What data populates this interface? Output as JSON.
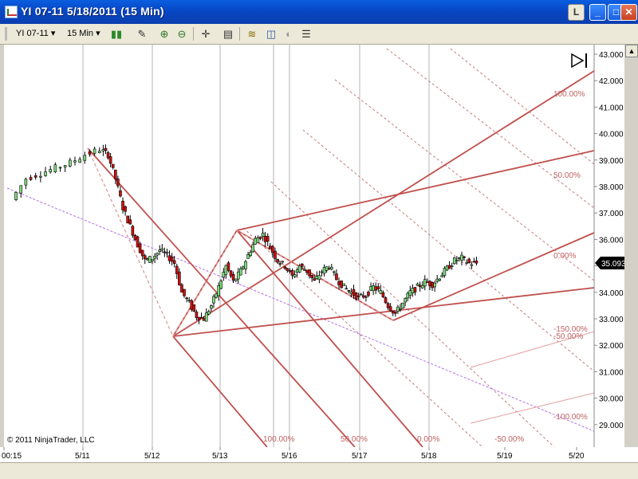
{
  "window": {
    "title": "YI 07-11  5/18/2011 (15 Min)",
    "btn_l": "L",
    "btn_min": "_",
    "btn_max": "□",
    "btn_close": "✕"
  },
  "toolbar": {
    "instrument": "YI 07-11",
    "interval": "15 Min",
    "dropdown_glyph": "▾"
  },
  "chart": {
    "copyright": "© 2011 NinjaTrader, LLC",
    "last_price": "35.093",
    "y_ticks": [
      "43.000",
      "42.000",
      "41.000",
      "40.000",
      "39.000",
      "38.000",
      "37.000",
      "36.000",
      "35.000",
      "34.000",
      "33.000",
      "32.000",
      "31.000",
      "30.000",
      "29.000"
    ],
    "x_ticks": [
      "00:15",
      "5/11",
      "5/12",
      "5/13",
      "5/16",
      "5/17",
      "5/18",
      "5/19",
      "5/20"
    ],
    "right_levels": [
      "100.00%",
      "50.00%",
      "0.00%",
      "-150.00%",
      "-50.00%",
      "-100.00%"
    ],
    "bottom_levels": [
      "100.00%",
      "50.00%",
      "0.00%",
      "-50.00%"
    ]
  },
  "chart_data": {
    "type": "candlestick",
    "y_range": [
      28.5,
      43.1
    ],
    "x_ticks": [
      "00:15",
      "5/11",
      "5/12",
      "5/13",
      "5/16",
      "5/17",
      "5/18",
      "5/19",
      "5/20"
    ],
    "last_price": 35.093,
    "price_path": [
      [
        0,
        37.5
      ],
      [
        2,
        38.3
      ],
      [
        4,
        38.5
      ],
      [
        6,
        38.7
      ],
      [
        8,
        38.9
      ],
      [
        10,
        39.2
      ],
      [
        12,
        39.4
      ],
      [
        13,
        39.2
      ],
      [
        14,
        38.3
      ],
      [
        15,
        37.2
      ],
      [
        16,
        36.5
      ],
      [
        17,
        35.8
      ],
      [
        18,
        35.2
      ],
      [
        19,
        35.3
      ],
      [
        20,
        35.6
      ],
      [
        21,
        35.4
      ],
      [
        22,
        35.1
      ],
      [
        23,
        34.0
      ],
      [
        24,
        33.6
      ],
      [
        25,
        33.1
      ],
      [
        26,
        33.0
      ],
      [
        27,
        33.5
      ],
      [
        28,
        34.2
      ],
      [
        29,
        35.0
      ],
      [
        30,
        34.4
      ],
      [
        31,
        34.8
      ],
      [
        32,
        35.4
      ],
      [
        33,
        36.0
      ],
      [
        34,
        36.2
      ],
      [
        35,
        35.7
      ],
      [
        36,
        35.2
      ],
      [
        37,
        35.0
      ],
      [
        38,
        34.6
      ],
      [
        39,
        35.0
      ],
      [
        40,
        34.8
      ],
      [
        41,
        34.4
      ],
      [
        42,
        34.8
      ],
      [
        43,
        35.0
      ],
      [
        44,
        34.5
      ],
      [
        45,
        34.2
      ],
      [
        46,
        34.0
      ],
      [
        47,
        33.8
      ],
      [
        48,
        33.9
      ],
      [
        49,
        34.2
      ],
      [
        50,
        34.0
      ],
      [
        51,
        33.5
      ],
      [
        52,
        33.2
      ],
      [
        53,
        33.6
      ],
      [
        54,
        34.0
      ],
      [
        55,
        34.2
      ],
      [
        56,
        34.4
      ],
      [
        57,
        34.3
      ],
      [
        58,
        34.6
      ],
      [
        59,
        34.9
      ],
      [
        60,
        35.2
      ],
      [
        61,
        35.3
      ],
      [
        62,
        35.1
      ],
      [
        63,
        35.1
      ]
    ],
    "levels_right": [
      "100.00%",
      "50.00%",
      "0.00%",
      "-150.00%",
      "-50.00%",
      "-100.00%"
    ],
    "levels_bottom": [
      "100.00%",
      "50.00%",
      "0.00%",
      "-50.00%"
    ]
  }
}
